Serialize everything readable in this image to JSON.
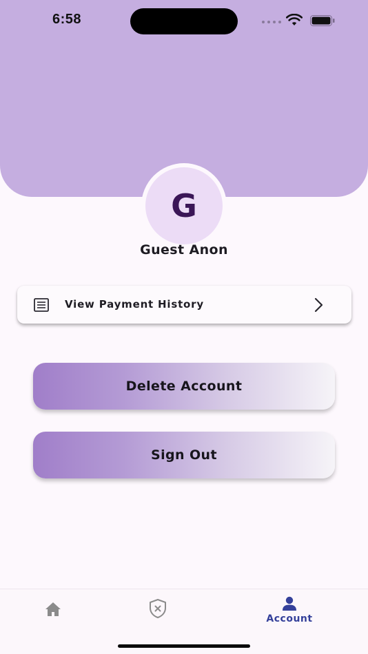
{
  "status_bar": {
    "time": "6:58"
  },
  "profile": {
    "avatar_letter": "G",
    "name": "Guest Anon"
  },
  "payment_history": {
    "label": "View Payment History"
  },
  "actions": {
    "delete_label": "Delete Account",
    "signout_label": "Sign Out"
  },
  "tab_bar": {
    "tabs": [
      {
        "icon": "home-icon",
        "label": ""
      },
      {
        "icon": "shield-x-icon",
        "label": ""
      },
      {
        "icon": "person-icon",
        "label": "Account",
        "active": true
      }
    ]
  },
  "colors": {
    "header": "#c5aee0",
    "avatar_bg": "#ecdcf6",
    "avatar_letter": "#3b1657",
    "active_tab": "#34409a",
    "inactive_tab": "#8a8a8a",
    "button_gradient_start": "#a07ec9",
    "button_gradient_end": "#f6f4f8"
  }
}
